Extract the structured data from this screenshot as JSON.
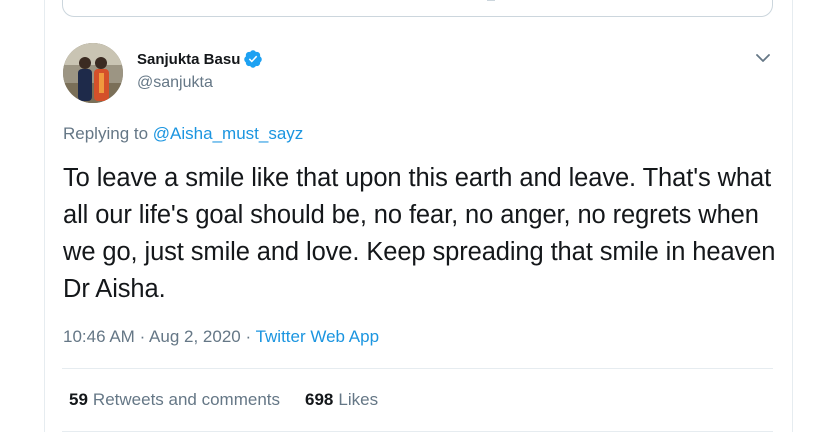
{
  "tweet": {
    "author": {
      "display_name": "Sanjukta Basu",
      "handle": "@sanjukta",
      "verified": true
    },
    "replying_prefix": "Replying to",
    "replying_to": "@Aisha_must_sayz",
    "text": "To leave a smile like that upon this earth and leave. That's what all our life's goal should be, no fear, no anger, no regrets when we go, just smile and love. Keep spreading that smile in heaven Dr Aisha.",
    "time": "10:46 AM",
    "date": "Aug 2, 2020",
    "source": "Twitter Web App",
    "separator": "·"
  },
  "stats": {
    "retweets_count": "59",
    "retweets_label": "Retweets and comments",
    "likes_count": "698",
    "likes_label": "Likes"
  },
  "icons": {
    "verified": "verified-badge-icon",
    "more": "chevron-down-icon"
  },
  "colors": {
    "link": "#1b95e0",
    "verified": "#1da1f2",
    "muted": "#657786",
    "text": "#14171a"
  }
}
